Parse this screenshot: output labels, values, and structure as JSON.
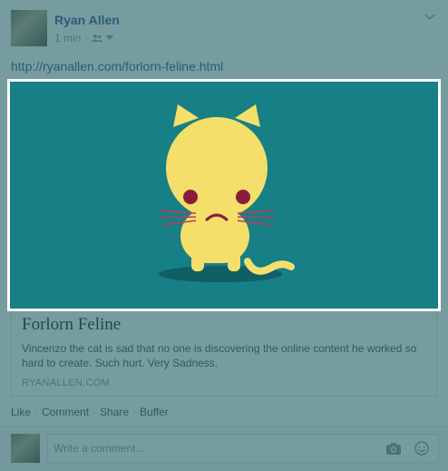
{
  "post": {
    "author": "Ryan Allen",
    "time": "1 min",
    "meta_sep": "·",
    "audience_icon": "friends-icon",
    "link_text": "http://ryanallen.com/forlorn-feline.html"
  },
  "card": {
    "title": "Forlorn Feline",
    "description": "Vincenzo the cat is sad that no one is discovering the online content he worked so hard to create. Such hurt. Very Sadness.",
    "domain": "RYANALLEN.COM",
    "image_bg": "#177f86",
    "cat_color": "#f4df6a"
  },
  "actions": {
    "like": "Like",
    "comment": "Comment",
    "share": "Share",
    "buffer": "Buffer",
    "sep": "·"
  },
  "comment_box": {
    "placeholder": "Write a comment...",
    "camera_icon": "camera-icon",
    "emoji_icon": "smiley-icon"
  },
  "colors": {
    "link": "#3b5998",
    "overlay": "#225f64",
    "frame": "#ffffff"
  }
}
